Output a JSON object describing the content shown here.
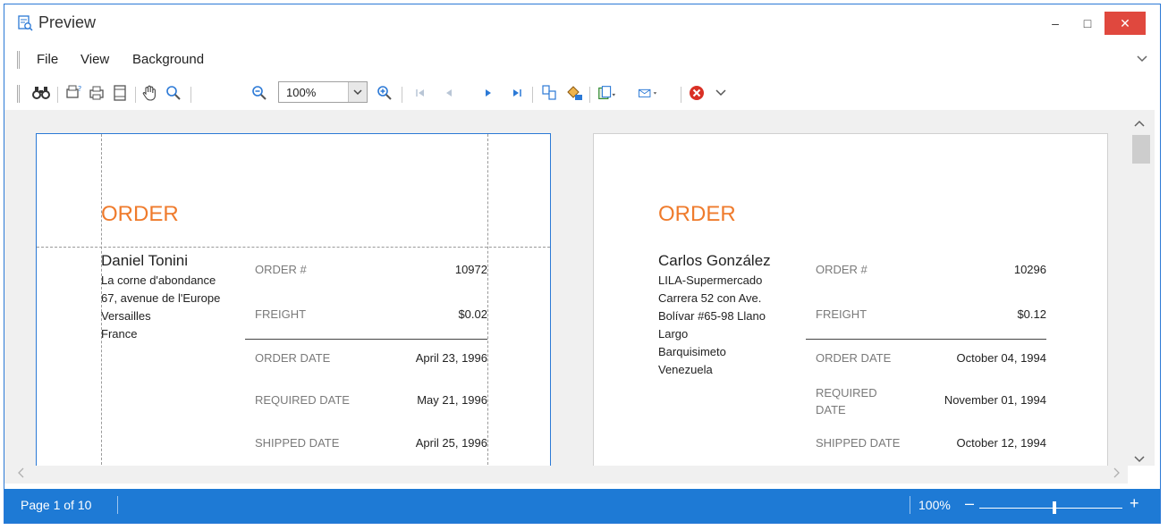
{
  "window": {
    "title": "Preview",
    "title_icon": "preview-icon"
  },
  "window_controls": {
    "minimize": "–",
    "maximize": "□",
    "close": "✕"
  },
  "menu": {
    "items": [
      "File",
      "View",
      "Background"
    ],
    "more_icon": "chevron-down-icon"
  },
  "toolbar": {
    "zoom_value": "100%",
    "icons": [
      "find-icon",
      "page-setup-icon",
      "print-icon",
      "quick-print-icon",
      "header-footer-icon",
      "hand-tool-icon",
      "magnifier-icon",
      "zoom-out-icon",
      "zoom-in-icon",
      "first-page-icon",
      "previous-page-icon",
      "next-page-icon",
      "last-page-icon",
      "multiple-pages-icon",
      "fill-background-icon",
      "export-icon",
      "send-email-icon",
      "close-preview-icon"
    ]
  },
  "pages": [
    {
      "heading": "ORDER",
      "customer_name": "Daniel Tonini",
      "address_lines": [
        "La corne d'abondance",
        "67, avenue de l'Europe",
        "Versailles",
        "France"
      ],
      "fields": [
        {
          "label": "ORDER #",
          "value": "10972"
        },
        {
          "label": "FREIGHT",
          "value": "$0.02"
        },
        {
          "label": "ORDER DATE",
          "value": "April 23, 1996"
        },
        {
          "label": "REQUIRED DATE",
          "value": "May 21, 1996"
        },
        {
          "label": "SHIPPED DATE",
          "value": "April 25, 1996"
        }
      ]
    },
    {
      "heading": "ORDER",
      "customer_name": "Carlos González",
      "address_lines": [
        "LILA-Supermercado",
        "Carrera 52 con Ave.",
        "Bolívar #65-98 Llano",
        "Largo",
        "Barquisimeto",
        "Venezuela"
      ],
      "fields": [
        {
          "label": "ORDER #",
          "value": "10296"
        },
        {
          "label": "FREIGHT",
          "value": "$0.12"
        },
        {
          "label": "ORDER DATE",
          "value": "October 04, 1994"
        },
        {
          "label": "REQUIRED DATE",
          "value": "November 01, 1994"
        },
        {
          "label": "SHIPPED DATE",
          "value": "October 12, 1994"
        }
      ]
    }
  ],
  "status": {
    "page_info": "Page 1 of 10",
    "zoom": "100%",
    "zoom_minus": "–",
    "zoom_plus": "+",
    "zoom_level_percent": 100
  },
  "colors": {
    "accent": "#1e7ad5",
    "heading": "#ef7b2c",
    "close_button": "#e0483e"
  }
}
